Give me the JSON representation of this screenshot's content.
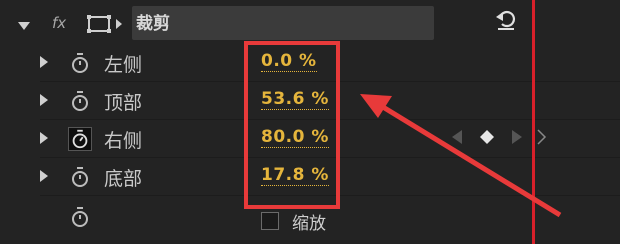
{
  "effect": {
    "fx_label": "fx",
    "title": "裁剪"
  },
  "properties": [
    {
      "label": "左侧",
      "value": "0.0 %"
    },
    {
      "label": "顶部",
      "value": "53.6 %"
    },
    {
      "label": "右侧",
      "value": "80.0 %"
    },
    {
      "label": "底部",
      "value": "17.8 %"
    }
  ],
  "zoom": {
    "checkbox_label": "缩放",
    "checked": false
  },
  "colors": {
    "value_text": "#e5b53c",
    "annotation_red": "#e83a3a",
    "playhead": "#d8202a",
    "panel_bg": "#232323"
  },
  "icons": [
    "expand-arrow-icon",
    "fx-icon",
    "crop-mask-icon",
    "stopwatch-icon",
    "reset-icon",
    "keyframe-prev-icon",
    "keyframe-add-icon",
    "keyframe-next-icon"
  ]
}
